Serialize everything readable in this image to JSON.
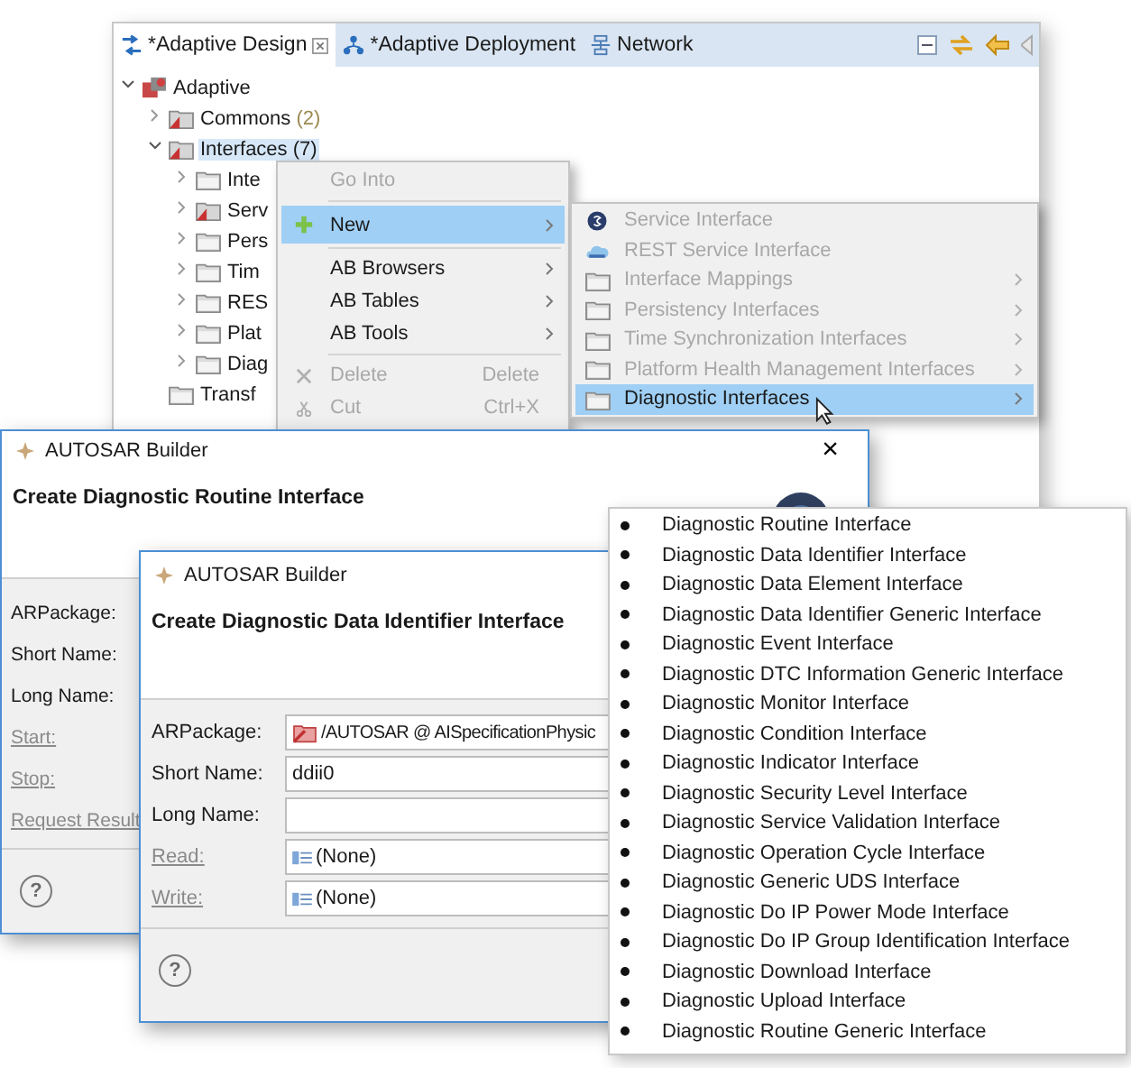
{
  "editor": {
    "tabs": [
      {
        "label": "*Adaptive Design",
        "selected": true
      },
      {
        "label": "*Adaptive Deployment",
        "selected": false
      },
      {
        "label": "Network",
        "selected": false
      }
    ],
    "tree": [
      {
        "label": "Adaptive",
        "kind": "root",
        "expanded": true,
        "selected": false,
        "children": [
          {
            "label": "Commons",
            "count": "(2)",
            "kind": "package",
            "expanded": false,
            "selected": false
          },
          {
            "label": "Interfaces",
            "count": "(7)",
            "kind": "package",
            "expanded": true,
            "selected": true,
            "children": [
              {
                "label": "Inte",
                "kind": "folder",
                "expanded": false,
                "selected": false
              },
              {
                "label": "Serv",
                "kind": "package",
                "expanded": false,
                "selected": false
              },
              {
                "label": "Pers",
                "kind": "folder",
                "expanded": false,
                "selected": false
              },
              {
                "label": "Tim",
                "kind": "folder",
                "expanded": false,
                "selected": false
              },
              {
                "label": "RES",
                "kind": "folder",
                "expanded": false,
                "selected": false
              },
              {
                "label": "Plat",
                "kind": "folder",
                "expanded": false,
                "selected": false
              },
              {
                "label": "Diag",
                "kind": "folder",
                "expanded": false,
                "selected": false
              }
            ]
          },
          {
            "label": "Transf",
            "kind": "folder",
            "selected": false
          }
        ]
      }
    ]
  },
  "context_menu": {
    "items": [
      {
        "kind": "plain",
        "label": "Go Into",
        "disabled": true,
        "selected": false
      },
      {
        "kind": "separator"
      },
      {
        "kind": "add",
        "label": "New",
        "disabled": false,
        "selected": true,
        "submenu": true
      },
      {
        "kind": "separator"
      },
      {
        "kind": "plain",
        "label": "AB Browsers",
        "disabled": false,
        "selected": false,
        "submenu": true
      },
      {
        "kind": "plain",
        "label": "AB Tables",
        "disabled": false,
        "selected": false,
        "submenu": true
      },
      {
        "kind": "plain",
        "label": "AB Tools",
        "disabled": false,
        "selected": false,
        "submenu": true
      },
      {
        "kind": "separator"
      },
      {
        "kind": "delete",
        "label": "Delete",
        "shortcut": "Delete",
        "disabled": true,
        "selected": false
      },
      {
        "kind": "cut",
        "label": "Cut",
        "shortcut": "Ctrl+X",
        "disabled": true,
        "selected": false
      }
    ]
  },
  "submenu": {
    "items": [
      {
        "label": "Service Interface",
        "kind": "service",
        "disabled": true,
        "selected": false,
        "submenu": false
      },
      {
        "label": "REST Service Interface",
        "kind": "rest",
        "disabled": true,
        "selected": false,
        "submenu": false
      },
      {
        "label": "Interface Mappings",
        "kind": "folder",
        "disabled": true,
        "selected": false,
        "submenu": true
      },
      {
        "label": "Persistency Interfaces",
        "kind": "folder",
        "disabled": true,
        "selected": false,
        "submenu": true
      },
      {
        "label": "Time Synchronization Interfaces",
        "kind": "folder",
        "disabled": true,
        "selected": false,
        "submenu": true
      },
      {
        "label": "Platform Health Management Interfaces",
        "kind": "folder",
        "disabled": true,
        "selected": false,
        "submenu": true
      },
      {
        "label": "Diagnostic Interfaces",
        "kind": "folder",
        "disabled": false,
        "selected": true,
        "submenu": true
      }
    ]
  },
  "dialogs": [
    {
      "title": "AUTOSAR Builder",
      "close": "×",
      "heading": "Create Diagnostic Routine Interface",
      "help": "?",
      "fields": [
        {
          "label": "ARPackage:",
          "kind": "label"
        },
        {
          "label": "Short Name:",
          "kind": "label"
        },
        {
          "label": "Long Name:",
          "kind": "label"
        },
        {
          "label": "Start:",
          "kind": "link"
        },
        {
          "label": "Stop:",
          "kind": "link"
        },
        {
          "label": "Request Result",
          "kind": "link"
        }
      ]
    },
    {
      "title": "AUTOSAR Builder",
      "heading": "Create Diagnostic Data Identifier Interface",
      "help": "?",
      "fields": [
        {
          "label": "ARPackage:",
          "kind": "package",
          "value": "/AUTOSAR @ AISpecificationPhysic"
        },
        {
          "label": "Short Name:",
          "kind": "text",
          "value": "ddii0"
        },
        {
          "label": "Long Name:",
          "kind": "text"
        },
        {
          "label": "Read:",
          "kind": "link",
          "value": "(None)"
        },
        {
          "label": "Write:",
          "kind": "link",
          "value": "(None)"
        }
      ]
    }
  ],
  "popup_list": {
    "items": [
      "Diagnostic Routine Interface",
      "Diagnostic Data Identifier Interface",
      "Diagnostic Data Element Interface",
      "Diagnostic Data Identifier Generic Interface",
      "Diagnostic Event Interface",
      "Diagnostic DTC Information Generic Interface",
      "Diagnostic Monitor Interface",
      "Diagnostic Condition Interface",
      "Diagnostic Indicator Interface",
      "Diagnostic Security Level Interface",
      "Diagnostic Service Validation Interface",
      "Diagnostic Operation Cycle Interface",
      "Diagnostic Generic UDS Interface",
      "Diagnostic Do IP Power Mode Interface",
      "Diagnostic Do IP Group Identification Interface",
      "Diagnostic Download Interface",
      "Diagnostic Upload Interface",
      "Diagnostic Routine Generic Interface"
    ]
  }
}
